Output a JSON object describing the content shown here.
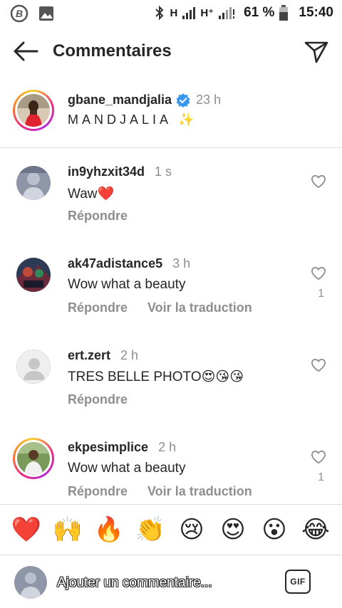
{
  "status_bar": {
    "network1": "H",
    "network2": "H⁺",
    "battery": "61 %",
    "time": "15:40"
  },
  "header": {
    "title": "Commentaires"
  },
  "caption": {
    "username": "gbane_mandjalia",
    "time": "23 h",
    "text": "MANDJALIA ✨"
  },
  "comments": [
    {
      "username": "in9yhzxit34d",
      "time": "1 s",
      "text": "Waw❤️",
      "reply": "Répondre",
      "translate": "",
      "likes": ""
    },
    {
      "username": "ak47adistance5",
      "time": "3 h",
      "text": "Wow what a beauty",
      "reply": "Répondre",
      "translate": "Voir la traduction",
      "likes": "1"
    },
    {
      "username": "ert.zert",
      "time": "2 h",
      "text": "TRES BELLE PHOTO😍😘😘",
      "reply": "Répondre",
      "translate": "",
      "likes": ""
    },
    {
      "username": "ekpesimplice",
      "time": "2 h",
      "text": "Wow what a beauty",
      "reply": "Répondre",
      "translate": "Voir la traduction",
      "likes": "1"
    }
  ],
  "emoji_bar": [
    "❤️",
    "🙌",
    "🔥",
    "👏",
    "😢",
    "😍",
    "😮",
    "😂"
  ],
  "composer": {
    "placeholder": "Ajouter un commentaire...",
    "gif_label": "GIF"
  },
  "colors": {
    "verified": "#3897f0",
    "muted": "#8e8e8e",
    "heart_red": "#ed4956"
  }
}
